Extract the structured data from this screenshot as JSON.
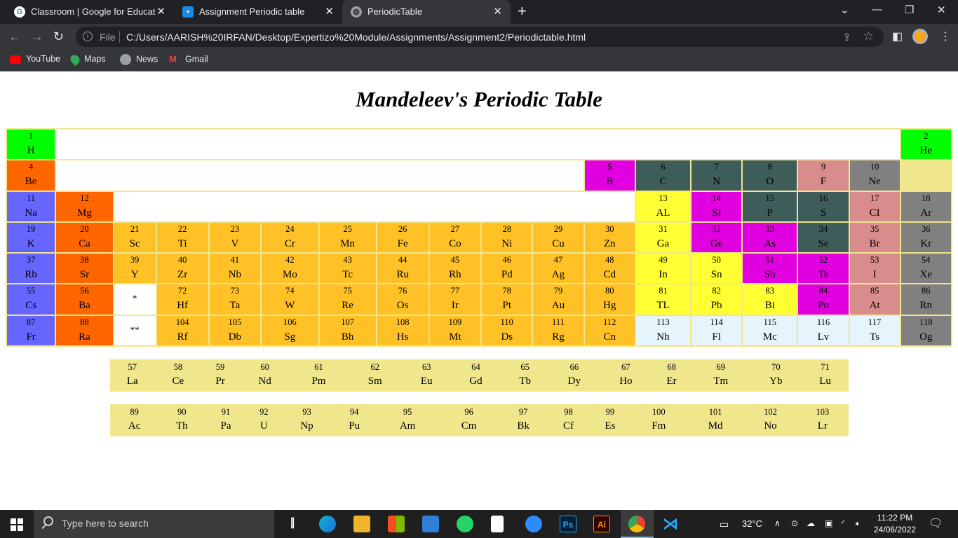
{
  "browser": {
    "tabs": [
      {
        "title": "Classroom | Google for Education",
        "icon": "google-icon"
      },
      {
        "title": "Assignment Periodic table",
        "icon": "classroom-icon"
      },
      {
        "title": "PeriodicTable",
        "icon": "globe-icon"
      }
    ],
    "new_tab": "+",
    "address_scheme": "File",
    "url": "C:/Users/AARISH%20IRFAN/Desktop/Expertizo%20Module/Assignments/Assignment2/Periodictable.html",
    "bookmarks": [
      "YouTube",
      "Maps",
      "News",
      "Gmail"
    ]
  },
  "page": {
    "title": "Mandeleev's Periodic Table"
  },
  "colors": {
    "hydrogen_helium": "#00ff00",
    "alkaline": "#ff6600",
    "transition": "#ffc125",
    "post_transition": "#ffff33",
    "metalloid": "#e100e0",
    "nonmetal": "#3d5c5a",
    "halogen": "#d98c8c",
    "noble_gas": "#808080",
    "alkali": "#6666ff",
    "unknown": "#e6f5fc",
    "series_bg": "#f0e68c"
  },
  "table": {
    "rows": [
      [
        {
          "n": "1",
          "s": "H",
          "c": "c-h"
        },
        {
          "blank": true,
          "span": 16,
          "c": "c-w"
        },
        {
          "n": "2",
          "s": "He",
          "c": "c-h"
        }
      ],
      [
        {
          "n": "4",
          "s": "Be",
          "c": "c-al"
        },
        {
          "blank": true,
          "span": 10,
          "c": "c-w"
        },
        {
          "n": "5",
          "s": "B",
          "c": "c-md"
        },
        {
          "n": "6",
          "s": "C",
          "c": "c-nm"
        },
        {
          "n": "7",
          "s": "N",
          "c": "c-nm"
        },
        {
          "n": "8",
          "s": "O",
          "c": "c-nm"
        },
        {
          "n": "9",
          "s": "F",
          "c": "c-ha"
        },
        {
          "n": "10",
          "s": "Ne",
          "c": "c-ng"
        },
        {
          "blank": true,
          "span": 1,
          "c": "c-kh"
        }
      ],
      [
        {
          "n": "11",
          "s": "Na",
          "c": "c-ak"
        },
        {
          "n": "12",
          "s": "Mg",
          "c": "c-al"
        },
        {
          "blank": true,
          "span": 10,
          "c": "c-w"
        },
        {
          "n": "13",
          "s": "AL",
          "c": "c-pt"
        },
        {
          "n": "14",
          "s": "SI",
          "c": "c-md"
        },
        {
          "n": "15",
          "s": "P",
          "c": "c-nm"
        },
        {
          "n": "16",
          "s": "S",
          "c": "c-nm"
        },
        {
          "n": "17",
          "s": "CI",
          "c": "c-ha"
        },
        {
          "n": "18",
          "s": "Ar",
          "c": "c-ng"
        }
      ],
      [
        {
          "n": "19",
          "s": "K",
          "c": "c-ak"
        },
        {
          "n": "20",
          "s": "Ca",
          "c": "c-al"
        },
        {
          "n": "21",
          "s": "Sc",
          "c": "c-tm"
        },
        {
          "n": "22",
          "s": "Ti",
          "c": "c-tm"
        },
        {
          "n": "23",
          "s": "V",
          "c": "c-tm"
        },
        {
          "n": "24",
          "s": "Cr",
          "c": "c-tm"
        },
        {
          "n": "25",
          "s": "Mn",
          "c": "c-tm"
        },
        {
          "n": "26",
          "s": "Fe",
          "c": "c-tm"
        },
        {
          "n": "27",
          "s": "Co",
          "c": "c-tm"
        },
        {
          "n": "28",
          "s": "Ni",
          "c": "c-tm"
        },
        {
          "n": "29",
          "s": "Cu",
          "c": "c-tm"
        },
        {
          "n": "30",
          "s": "Zn",
          "c": "c-tm"
        },
        {
          "n": "31",
          "s": "Ga",
          "c": "c-pt"
        },
        {
          "n": "32",
          "s": "Ge",
          "c": "c-md"
        },
        {
          "n": "33",
          "s": "As",
          "c": "c-md"
        },
        {
          "n": "34",
          "s": "Se",
          "c": "c-nm"
        },
        {
          "n": "35",
          "s": "Br",
          "c": "c-ha"
        },
        {
          "n": "36",
          "s": "Kr",
          "c": "c-ng"
        }
      ],
      [
        {
          "n": "37",
          "s": "Rb",
          "c": "c-ak"
        },
        {
          "n": "38",
          "s": "Sr",
          "c": "c-al"
        },
        {
          "n": "39",
          "s": "Y",
          "c": "c-tm"
        },
        {
          "n": "40",
          "s": "Zr",
          "c": "c-tm"
        },
        {
          "n": "41",
          "s": "Nb",
          "c": "c-tm"
        },
        {
          "n": "42",
          "s": "Mo",
          "c": "c-tm"
        },
        {
          "n": "43",
          "s": "Tc",
          "c": "c-tm"
        },
        {
          "n": "44",
          "s": "Ru",
          "c": "c-tm"
        },
        {
          "n": "45",
          "s": "Rh",
          "c": "c-tm"
        },
        {
          "n": "46",
          "s": "Pd",
          "c": "c-tm"
        },
        {
          "n": "47",
          "s": "Ag",
          "c": "c-tm"
        },
        {
          "n": "48",
          "s": "Cd",
          "c": "c-tm"
        },
        {
          "n": "49",
          "s": "In",
          "c": "c-pt"
        },
        {
          "n": "50",
          "s": "Sn",
          "c": "c-pt"
        },
        {
          "n": "51",
          "s": "Sb",
          "c": "c-md"
        },
        {
          "n": "52",
          "s": "Te",
          "c": "c-md"
        },
        {
          "n": "53",
          "s": "I",
          "c": "c-ha"
        },
        {
          "n": "54",
          "s": "Xe",
          "c": "c-ng"
        }
      ],
      [
        {
          "n": "55",
          "s": "Cs",
          "c": "c-ak"
        },
        {
          "n": "56",
          "s": "Ba",
          "c": "c-al"
        },
        {
          "star": "*",
          "c": "c-w"
        },
        {
          "n": "72",
          "s": "Hf",
          "c": "c-tm"
        },
        {
          "n": "73",
          "s": "Ta",
          "c": "c-tm"
        },
        {
          "n": "74",
          "s": "W",
          "c": "c-tm"
        },
        {
          "n": "75",
          "s": "Re",
          "c": "c-tm"
        },
        {
          "n": "76",
          "s": "Os",
          "c": "c-tm"
        },
        {
          "n": "77",
          "s": "Ir",
          "c": "c-tm"
        },
        {
          "n": "78",
          "s": "Pt",
          "c": "c-tm"
        },
        {
          "n": "79",
          "s": "Au",
          "c": "c-tm"
        },
        {
          "n": "80",
          "s": "Hg",
          "c": "c-tm"
        },
        {
          "n": "81",
          "s": "TL",
          "c": "c-pt"
        },
        {
          "n": "82",
          "s": "Pb",
          "c": "c-pt"
        },
        {
          "n": "83",
          "s": "Bi",
          "c": "c-pt"
        },
        {
          "n": "84",
          "s": "Po",
          "c": "c-md"
        },
        {
          "n": "85",
          "s": "At",
          "c": "c-ha"
        },
        {
          "n": "86",
          "s": "Rn",
          "c": "c-ng"
        }
      ],
      [
        {
          "n": "87",
          "s": "Fr",
          "c": "c-ak"
        },
        {
          "n": "88",
          "s": "Ra",
          "c": "c-al"
        },
        {
          "star": "**",
          "c": "c-w"
        },
        {
          "n": "104",
          "s": "Rf",
          "c": "c-tm"
        },
        {
          "n": "105",
          "s": "Db",
          "c": "c-tm"
        },
        {
          "n": "106",
          "s": "Sg",
          "c": "c-tm"
        },
        {
          "n": "107",
          "s": "Bh",
          "c": "c-tm"
        },
        {
          "n": "108",
          "s": "Hs",
          "c": "c-tm"
        },
        {
          "n": "109",
          "s": "Mt",
          "c": "c-tm"
        },
        {
          "n": "110",
          "s": "Ds",
          "c": "c-tm"
        },
        {
          "n": "111",
          "s": "Rg",
          "c": "c-tm"
        },
        {
          "n": "112",
          "s": "Cn",
          "c": "c-tm"
        },
        {
          "n": "113",
          "s": "Nh",
          "c": "c-un"
        },
        {
          "n": "114",
          "s": "Fl",
          "c": "c-un"
        },
        {
          "n": "115",
          "s": "Mc",
          "c": "c-un"
        },
        {
          "n": "116",
          "s": "Lv",
          "c": "c-un"
        },
        {
          "n": "117",
          "s": "Ts",
          "c": "c-un"
        },
        {
          "n": "118",
          "s": "Og",
          "c": "c-ng"
        }
      ]
    ]
  },
  "lanthanides": [
    {
      "n": "57",
      "s": "La"
    },
    {
      "n": "58",
      "s": "Ce"
    },
    {
      "n": "59",
      "s": "Pr"
    },
    {
      "n": "60",
      "s": "Nd"
    },
    {
      "n": "61",
      "s": "Pm"
    },
    {
      "n": "62",
      "s": "Sm"
    },
    {
      "n": "63",
      "s": "Eu"
    },
    {
      "n": "64",
      "s": "Gd"
    },
    {
      "n": "65",
      "s": "Tb"
    },
    {
      "n": "66",
      "s": "Dy"
    },
    {
      "n": "67",
      "s": "Ho"
    },
    {
      "n": "68",
      "s": "Er"
    },
    {
      "n": "69",
      "s": "Tm"
    },
    {
      "n": "70",
      "s": "Yb"
    },
    {
      "n": "71",
      "s": "Lu"
    }
  ],
  "actinides": [
    {
      "n": "89",
      "s": "Ac"
    },
    {
      "n": "90",
      "s": "Th"
    },
    {
      "n": "91",
      "s": "Pa"
    },
    {
      "n": "92",
      "s": "U"
    },
    {
      "n": "93",
      "s": "Np"
    },
    {
      "n": "94",
      "s": "Pu"
    },
    {
      "n": "95",
      "s": "Am"
    },
    {
      "n": "96",
      "s": "Cm"
    },
    {
      "n": "97",
      "s": "Bk"
    },
    {
      "n": "98",
      "s": "Cf"
    },
    {
      "n": "99",
      "s": "Es"
    },
    {
      "n": "100",
      "s": "Fm"
    },
    {
      "n": "101",
      "s": "Md"
    },
    {
      "n": "102",
      "s": "No"
    },
    {
      "n": "103",
      "s": "Lr"
    }
  ],
  "taskbar": {
    "search_placeholder": "Type here to search",
    "apps": [
      "task-view-icon",
      "edge-icon",
      "file-explorer-icon",
      "store-icon",
      "mail-icon",
      "whatsapp-icon",
      "file-icon",
      "zoom-icon",
      "photoshop-icon",
      "illustrator-icon",
      "chrome-icon",
      "vscode-icon"
    ],
    "ps_label": "Ps",
    "ai_label": "Ai",
    "temperature": "32°C",
    "time": "11:22 PM",
    "date": "24/06/2022"
  }
}
